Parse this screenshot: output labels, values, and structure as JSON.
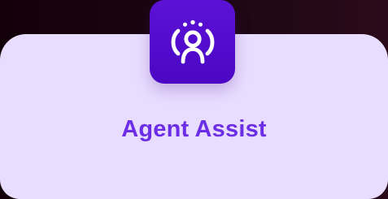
{
  "card": {
    "title": "Agent Assist",
    "icon": "agent-assist-person-icon",
    "colors": {
      "background": "#e9ddff",
      "title": "#6b2ee6",
      "icon_tile": "#4b07c3",
      "icon_stroke": "#ffffff"
    }
  }
}
